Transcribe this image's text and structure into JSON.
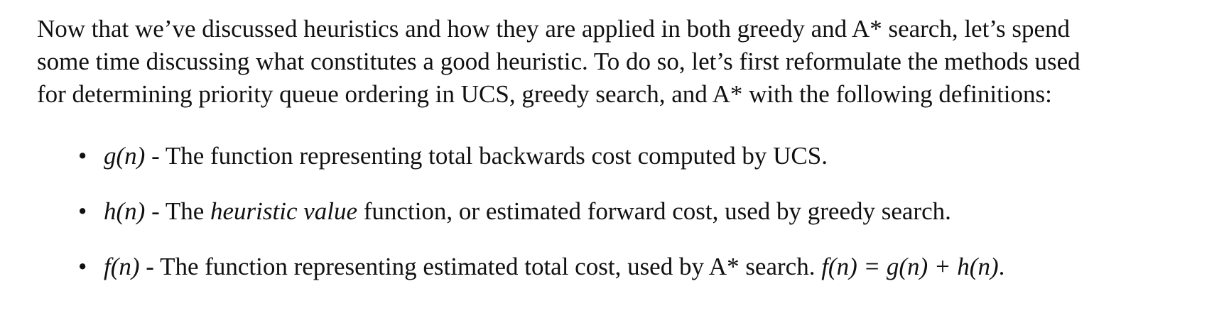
{
  "intro": {
    "line1": "Now that we’ve discussed heuristics and how they are applied in both greedy and A* search, let’s spend",
    "line2": "some time discussing what constitutes a good heuristic.  To do so, let’s first reformulate the methods used",
    "line3": "for determining priority queue ordering in UCS, greedy search, and A* with the following definitions:"
  },
  "bullets": [
    {
      "symbol": "g(n)",
      "text": " - The function representing total backwards cost computed by UCS."
    },
    {
      "symbol": "h(n)",
      "text_before": " - The ",
      "emphasis": "heuristic value",
      "text_after": " function, or estimated forward cost, used by greedy search."
    },
    {
      "symbol": "f(n)",
      "text": " - The function representing estimated total cost, used by A* search.  ",
      "formula": "f(n) = g(n) + h(n)",
      "end": "."
    }
  ]
}
